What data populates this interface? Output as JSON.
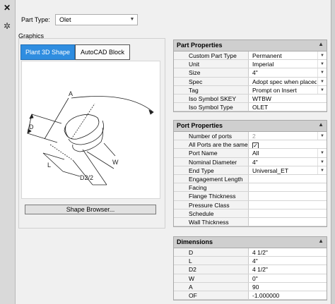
{
  "part_type": {
    "label": "Part Type:",
    "value": "Olet"
  },
  "graphics": {
    "label": "Graphics",
    "tabs": [
      "Plant 3D Shape",
      "AutoCAD Block"
    ],
    "shape_browser_button": "Shape Browser...",
    "dimension_labels": {
      "a": "A",
      "d": "D",
      "l": "L",
      "w": "W",
      "d2": "D2/2"
    }
  },
  "part_properties_1": {
    "title": "Part Properties",
    "rows": [
      {
        "key": "Custom Part Type",
        "value": "Permanent"
      },
      {
        "key": "Unit",
        "value": "Imperial"
      },
      {
        "key": "Size",
        "value": "4\""
      },
      {
        "key": "Spec",
        "value": "Adopt spec when placed"
      },
      {
        "key": "Tag",
        "value": "Prompt on Insert"
      },
      {
        "key": "Iso Symbol SKEY",
        "value": "WTBW"
      },
      {
        "key": "Iso Symbol Type",
        "value": "OLET"
      }
    ]
  },
  "part_properties_2": {
    "title": "Port Properties",
    "rows": [
      {
        "key": "Number of ports",
        "value": "2"
      },
      {
        "key": "All Ports are the same",
        "value": "✓"
      },
      {
        "key": "Port Name",
        "value": "All"
      },
      {
        "key": "Nominal Diameter",
        "value": "4\""
      },
      {
        "key": "End Type",
        "value": "Universal_ET"
      },
      {
        "key": "Engagement Length",
        "value": ""
      },
      {
        "key": "Facing",
        "value": ""
      },
      {
        "key": "Flange Thickness",
        "value": ""
      },
      {
        "key": "Pressure Class",
        "value": ""
      },
      {
        "key": "Schedule",
        "value": ""
      },
      {
        "key": "Wall Thickness",
        "value": ""
      }
    ]
  },
  "dimensions": {
    "title": "Dimensions",
    "rows": [
      {
        "key": "D",
        "value": "4 1/2\""
      },
      {
        "key": "L",
        "value": "4\""
      },
      {
        "key": "D2",
        "value": "4 1/2\""
      },
      {
        "key": "W",
        "value": "0\""
      },
      {
        "key": "A",
        "value": "90"
      },
      {
        "key": "OF",
        "value": "-1.000000"
      }
    ]
  },
  "icons": {
    "pin": "pin-icon",
    "settings": "settings-icon"
  }
}
